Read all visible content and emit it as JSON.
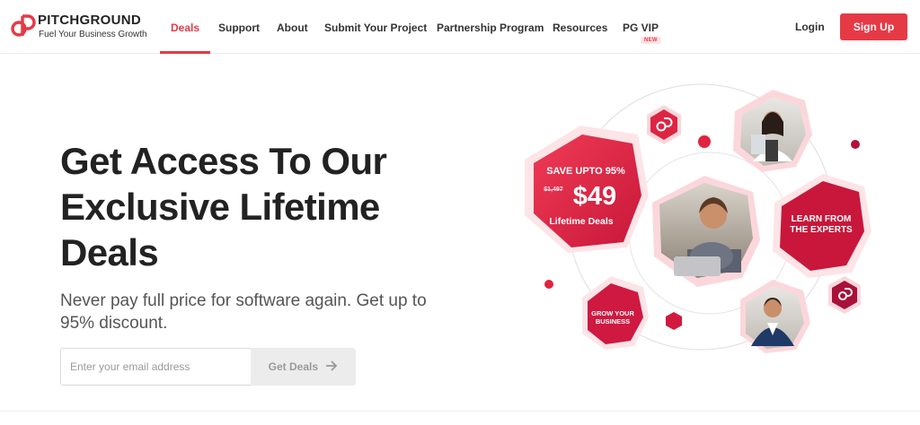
{
  "brand": {
    "name": "PITCHGROUND",
    "tagline": "Fuel Your Business Growth",
    "accent": "#e63946"
  },
  "nav": {
    "items": [
      {
        "label": "Deals",
        "active": true
      },
      {
        "label": "Support"
      },
      {
        "label": "About"
      },
      {
        "label": "Submit Your Project"
      },
      {
        "label": "Partnership Program"
      },
      {
        "label": "Resources"
      },
      {
        "label": "PG VIP"
      }
    ],
    "badge": "NEW",
    "login": "Login",
    "signup": "Sign Up"
  },
  "hero": {
    "title": "Get Access To Our Exclusive Lifetime Deals",
    "subtitle": "Never pay full price for software again. Get up to 95% discount.",
    "email_placeholder": "Enter your email address",
    "cta_label": "Get Deals",
    "cta_icon": "arrow-right-icon"
  },
  "illustration": {
    "deal_hex": {
      "line1": "SAVE UPTO 95%",
      "old_price": "$1,497",
      "price": "$49",
      "line3": "Lifetime Deals"
    },
    "experts_hex": {
      "line1": "LEARN FROM",
      "line2": "THE EXPERTS"
    },
    "grow_hex": {
      "line1": "GROW YOUR",
      "line2": "BUSINESS"
    }
  }
}
